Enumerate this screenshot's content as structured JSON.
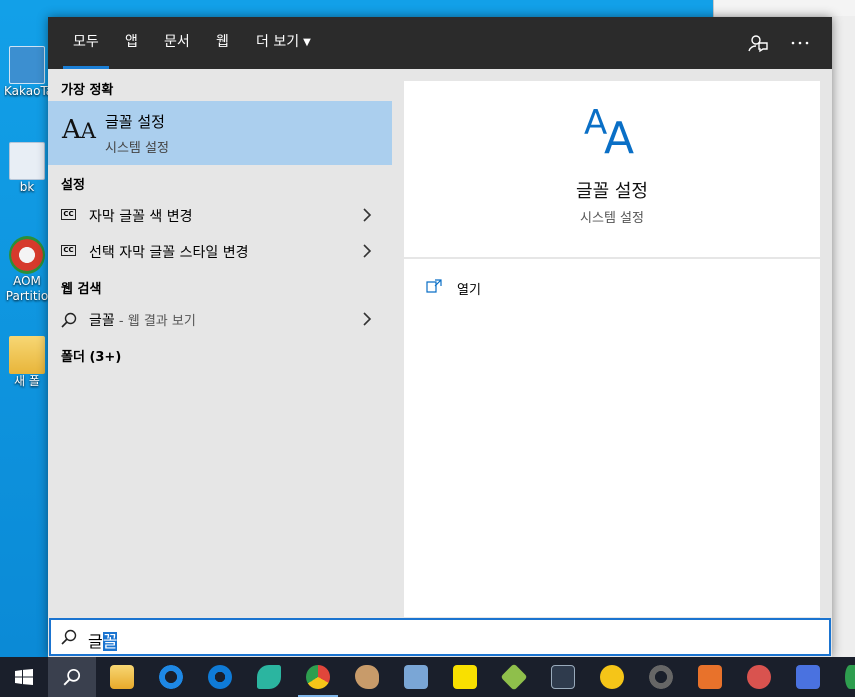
{
  "desktop": {
    "icons": [
      {
        "label": "KakaoTa",
        "color": "#3c8fd0"
      },
      {
        "label": "bk",
        "color": "#e8eef5"
      },
      {
        "label": "AOM",
        "label2": "Partitio",
        "color": "#d63a2c"
      },
      {
        "label": "새 폴",
        "color": "#f2c94c"
      }
    ]
  },
  "search_panel": {
    "tabs": [
      {
        "label": "모두",
        "active": true
      },
      {
        "label": "앱"
      },
      {
        "label": "문서"
      },
      {
        "label": "웹"
      },
      {
        "label": "더 보기"
      }
    ],
    "feedback_icon": "feedback-person-icon",
    "more_icon": "ellipsis-icon",
    "best_match": {
      "heading": "가장 정확",
      "title": "글꼴 설정",
      "subtitle": "시스템 설정",
      "icon": "font-aa-icon"
    },
    "settings": {
      "heading": "설정",
      "items": [
        {
          "label": "자막 글꼴 색 변경",
          "icon": "closed-caption-icon"
        },
        {
          "label": "선택 자막 글꼴 스타일 변경",
          "icon": "closed-caption-icon"
        }
      ]
    },
    "web_search": {
      "heading": "웹 검색",
      "query": "글꼴",
      "suffix": " - 웹 결과 보기"
    },
    "folders": {
      "heading": "폴더 (3+)"
    },
    "preview": {
      "title": "글꼴 설정",
      "subtitle": "시스템 설정",
      "actions": [
        {
          "label": "열기",
          "icon": "open-window-icon"
        }
      ]
    },
    "search_box": {
      "text_before": "글",
      "text_selected": "꼴"
    }
  },
  "taskbar": {
    "items": [
      {
        "name": "start-button",
        "color": "#ffffff"
      },
      {
        "name": "search-button",
        "color": "#ffffff"
      },
      {
        "name": "file-explorer",
        "color": "#f2b632"
      },
      {
        "name": "internet-explorer",
        "color": "#1e88e5"
      },
      {
        "name": "edge",
        "color": "#0f7bd7"
      },
      {
        "name": "app-teal",
        "color": "#2bb5a0"
      },
      {
        "name": "chrome",
        "color": "#e0463b"
      },
      {
        "name": "paint",
        "color": "#c89b6a"
      },
      {
        "name": "notepad",
        "color": "#7aa6d6"
      },
      {
        "name": "kakaotalk",
        "color": "#f9e000"
      },
      {
        "name": "app-diamond",
        "color": "#8fbf4b"
      },
      {
        "name": "lightroom",
        "color": "#2f3b4d"
      },
      {
        "name": "media-player",
        "color": "#f5c518"
      },
      {
        "name": "app-dark-ring",
        "color": "#555555"
      },
      {
        "name": "app-orange-eye",
        "color": "#e8722b"
      },
      {
        "name": "app-red-disc",
        "color": "#d9534f"
      },
      {
        "name": "app-blue-s",
        "color": "#4a72e0"
      },
      {
        "name": "app-green",
        "color": "#2e9e4f"
      }
    ]
  }
}
